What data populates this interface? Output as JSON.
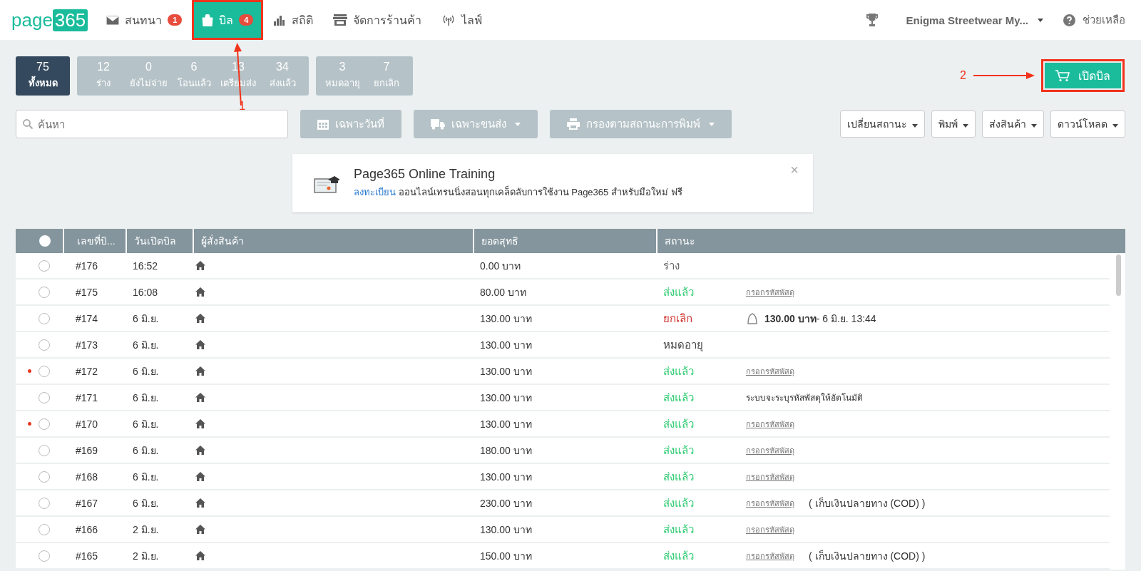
{
  "logo": "page365",
  "nav": [
    {
      "label": "สนทนา",
      "badge": "1",
      "selected": false
    },
    {
      "label": "บิล",
      "badge": "4",
      "selected": true,
      "annotation": "1"
    },
    {
      "label": "สถิติ",
      "selected": false
    },
    {
      "label": "จัดการร้านค้า",
      "selected": false
    },
    {
      "label": "ไลฟ์",
      "selected": false
    }
  ],
  "shop_menu": "Enigma Streetwear My...",
  "help": "ช่วยเหลือ",
  "status_groups": [
    [
      {
        "count": "75",
        "label": "ทั้งหมด",
        "selected": true
      }
    ],
    [
      {
        "count": "12",
        "label": "ร่าง",
        "selected": false
      },
      {
        "count": "0",
        "label": "ยังไม่จ่าย",
        "selected": false
      },
      {
        "count": "6",
        "label": "โอนแล้ว",
        "selected": false
      },
      {
        "count": "13",
        "label": "เตรียมส่ง",
        "selected": false
      },
      {
        "count": "34",
        "label": "ส่งแล้ว",
        "selected": false
      }
    ],
    [
      {
        "count": "3",
        "label": "หมดอายุ",
        "selected": false
      },
      {
        "count": "7",
        "label": "ยกเลิก",
        "selected": false
      }
    ]
  ],
  "open_bill_button": {
    "label": "เปิดบิล",
    "annotation": "2"
  },
  "search": {
    "placeholder": "ค้นหา"
  },
  "filters": [
    {
      "label": "เฉพาะวันที่",
      "dropdown": false
    },
    {
      "label": "เฉพาะขนส่ง",
      "dropdown": true
    },
    {
      "label": "กรองตามสถานะการพิมพ์",
      "dropdown": true
    }
  ],
  "actions": [
    "เปลี่ยนสถานะ",
    "พิมพ์",
    "ส่งสินค้า",
    "ดาวน์โหลด"
  ],
  "banner": {
    "title": "Page365 Online Training",
    "link": "ลงทะเบียน",
    "text": "ออนไลน์เทรนนิ่งสอนทุกเคล็ดลับการใช้งาน Page365 สำหรับมือใหม่ ฟรี",
    "close": "×"
  },
  "table": {
    "all_checked": false,
    "columns": [
      "เลขที่บิ...",
      "วันเปิดบิล",
      "ผู้สั่งสินค้า",
      "ยอดสุทธิ",
      "สถานะ"
    ],
    "rows": [
      {
        "unread": false,
        "checked": false,
        "bill": "#176",
        "date": "16:52",
        "total": "0.00 บาท",
        "status": "ร่าง",
        "color": "#666666"
      },
      {
        "unread": false,
        "checked": false,
        "bill": "#175",
        "date": "16:08",
        "total": "80.00 บาท",
        "status": "ส่งแล้ว",
        "color": "#2ecc71",
        "link": "กรอกรหัสพัสดุ"
      },
      {
        "unread": false,
        "checked": false,
        "bill": "#174",
        "date": "6 มิ.ย.",
        "total": "130.00 บาท",
        "status": "ยกเลิก",
        "color": "#d0312d",
        "refund": "**130.00 บาท**- 6 มิ.ย. 13:44"
      },
      {
        "unread": false,
        "checked": false,
        "bill": "#173",
        "date": "6 มิ.ย.",
        "total": "130.00 บาท",
        "status": "หมดอายุ",
        "color": "#444444"
      },
      {
        "unread": true,
        "checked": false,
        "bill": "#172",
        "date": "6 มิ.ย.",
        "total": "130.00 บาท",
        "status": "ส่งแล้ว",
        "color": "#2ecc71",
        "link": "กรอกรหัสพัสดุ"
      },
      {
        "unread": false,
        "checked": false,
        "bill": "#171",
        "date": "6 มิ.ย.",
        "total": "130.00 บาท",
        "status": "ส่งแล้ว",
        "color": "#2ecc71",
        "note": "ระบบจะระบุรหัสพัสดุให้อัตโนมัติ"
      },
      {
        "unread": true,
        "checked": false,
        "bill": "#170",
        "date": "6 มิ.ย.",
        "total": "130.00 บาท",
        "status": "ส่งแล้ว",
        "color": "#2ecc71",
        "link": "กรอกรหัสพัสดุ"
      },
      {
        "unread": false,
        "checked": false,
        "bill": "#169",
        "date": "6 มิ.ย.",
        "total": "180.00 บาท",
        "status": "ส่งแล้ว",
        "color": "#2ecc71",
        "link": "กรอกรหัสพัสดุ"
      },
      {
        "unread": false,
        "checked": false,
        "bill": "#168",
        "date": "6 มิ.ย.",
        "total": "130.00 บาท",
        "status": "ส่งแล้ว",
        "color": "#2ecc71",
        "link": "กรอกรหัสพัสดุ"
      },
      {
        "unread": false,
        "checked": false,
        "bill": "#167",
        "date": "6 มิ.ย.",
        "total": "230.00 บาท",
        "status": "ส่งแล้ว",
        "color": "#2ecc71",
        "link": "กรอกรหัสพัสดุ",
        "payment": "( เก็บเงินปลายทาง (COD) )"
      },
      {
        "unread": false,
        "checked": false,
        "bill": "#166",
        "date": "2 มิ.ย.",
        "total": "130.00 บาท",
        "status": "ส่งแล้ว",
        "color": "#2ecc71",
        "link": "กรอกรหัสพัสดุ"
      },
      {
        "unread": false,
        "checked": false,
        "bill": "#165",
        "date": "2 มิ.ย.",
        "total": "150.00 บาท",
        "status": "ส่งแล้ว",
        "color": "#2ecc71",
        "link": "กรอกรหัสพัสดุ",
        "payment": "( เก็บเงินปลายทาง (COD) )"
      }
    ]
  }
}
